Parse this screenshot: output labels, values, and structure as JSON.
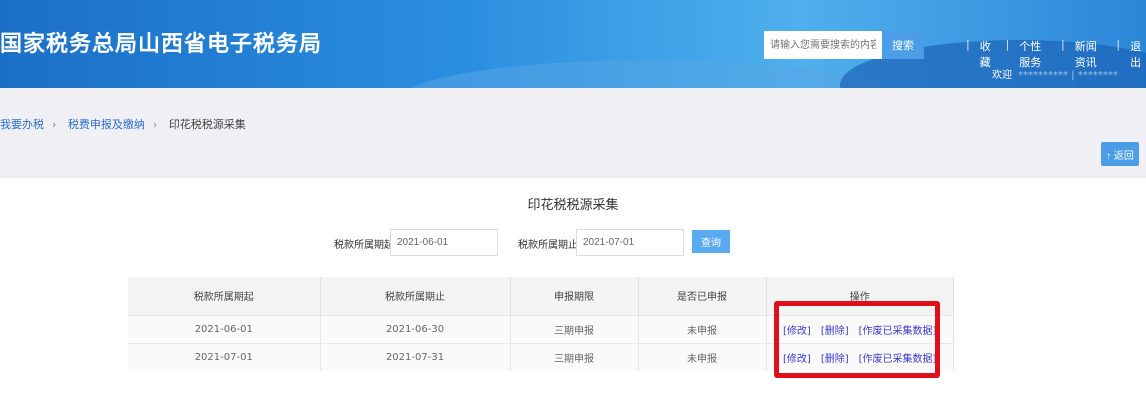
{
  "header": {
    "title": "国家税务总局山西省电子税务局",
    "search_placeholder": "请输入您需要搜索的内容",
    "search_button": "搜索",
    "links": [
      "收藏",
      "个性服务",
      "新闻资讯",
      "退出"
    ],
    "welcome": "欢迎",
    "user": "********** | ********"
  },
  "breadcrumb": [
    "我要办税",
    "税费申报及缴纳",
    "印花税税源采集"
  ],
  "back_button": "↑ 返回",
  "main": {
    "title": "印花税税源采集",
    "from_label": "税款所属期起",
    "from_value": "2021-06-01",
    "to_label": "税款所属期止",
    "to_value": "2021-07-01",
    "query_button": "查询",
    "columns": [
      "税款所属期起",
      "税款所属期止",
      "申报期限",
      "是否已申报",
      "操作"
    ],
    "rows": [
      {
        "start": "2021-06-01",
        "end": "2021-06-30",
        "period": "三期申报",
        "status": "未申报",
        "actions": [
          "[修改]",
          "[删除]",
          "[作废已采集数据]"
        ]
      },
      {
        "start": "2021-07-01",
        "end": "2021-07-31",
        "period": "三期申报",
        "status": "未申报",
        "actions": [
          "[修改]",
          "[删除]",
          "[作废已采集数据]"
        ]
      }
    ]
  },
  "colors": {
    "banner": "#2a8ee0",
    "button": "#4a9de6",
    "highlight": "#e0101a"
  }
}
